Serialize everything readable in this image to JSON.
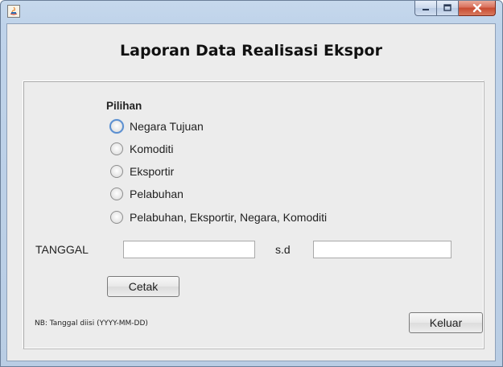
{
  "window": {
    "title": "",
    "controls": [
      "minimize-icon",
      "maximize-icon",
      "close-icon"
    ]
  },
  "heading": "Laporan Data Realisasi Ekspor",
  "options": {
    "title": "Pilihan",
    "items": [
      {
        "label": "Negara Tujuan"
      },
      {
        "label": "Komoditi"
      },
      {
        "label": "Eksportir"
      },
      {
        "label": "Pelabuhan"
      },
      {
        "label": "Pelabuhan, Eksportir, Negara, Komoditi"
      }
    ],
    "focused_index": 0
  },
  "date": {
    "label": "TANGGAL",
    "separator": "s.d",
    "from_value": "",
    "to_value": ""
  },
  "buttons": {
    "print": "Cetak",
    "exit": "Keluar"
  },
  "note": "NB: Tanggal diisi  (YYYY-MM-DD)"
}
